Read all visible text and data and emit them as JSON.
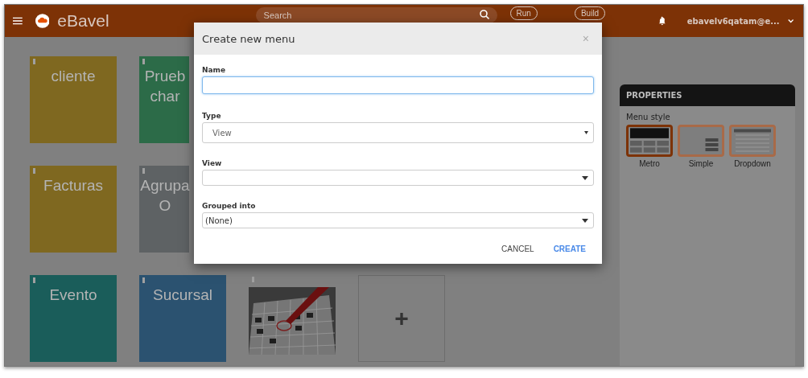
{
  "header": {
    "brand": "eBavel",
    "search": {
      "placeholder": "Search"
    },
    "buttons": [
      "Run",
      "Build"
    ],
    "user": "ebavelv6qatam@e..."
  },
  "tile_rows": [
    [
      {
        "kind": "text",
        "lines": [
          "cliente"
        ],
        "color": "#7f6820",
        "clipped": false
      },
      {
        "kind": "text",
        "lines": [
          "Prueb",
          "char"
        ],
        "color": "#2c6b48",
        "clipped": true
      }
    ],
    [
      {
        "kind": "text",
        "lines": [
          "Facturas"
        ],
        "color": "#7f6820",
        "clipped": false
      },
      {
        "kind": "text",
        "lines": [
          "Agrupa",
          "O"
        ],
        "color": "#5e6264",
        "clipped": true
      }
    ],
    [
      {
        "kind": "text",
        "lines": [
          "Evento"
        ],
        "color": "#1a5d5a",
        "clipped": false
      },
      {
        "kind": "text",
        "lines": [
          "Sucursal"
        ],
        "color": "#2b5270",
        "clipped": false
      },
      {
        "kind": "picture"
      },
      {
        "kind": "add",
        "label": "+"
      }
    ]
  ],
  "properties": {
    "title": "PROPERTIES",
    "section": "Menu style",
    "styles": [
      {
        "kind": "metro",
        "label": "Metro",
        "selected": true
      },
      {
        "kind": "simple",
        "label": "Simple",
        "selected": false
      },
      {
        "kind": "dropdown",
        "label": "Dropdown",
        "selected": false
      }
    ]
  },
  "dialog": {
    "title": "Create new menu",
    "close": "×",
    "fields": [
      {
        "kind": "input",
        "label": "Name",
        "focused": true
      },
      {
        "kind": "select",
        "label": "Type",
        "value": "View"
      },
      {
        "kind": "combo",
        "label": "View"
      },
      {
        "kind": "combo",
        "label": "Grouped into",
        "value": "(None)"
      }
    ],
    "buttons": [
      {
        "label": "CANCEL",
        "primary": false
      },
      {
        "label": "CREATE",
        "primary": true
      }
    ]
  }
}
